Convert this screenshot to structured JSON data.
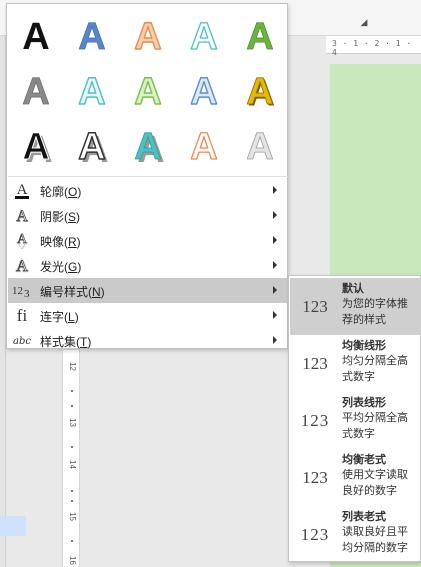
{
  "background": {
    "ruler_top_text": "3 · 1 · 2 · 1 · 4",
    "ruler_left_numbers": [
      "12",
      "13",
      "14",
      "15",
      "16"
    ]
  },
  "wordart_gallery": {
    "letter": "A",
    "styles": [
      {
        "fill": "#111111",
        "stroke": "#111111",
        "effect": "plain"
      },
      {
        "fill": "#5a86c6",
        "stroke": "#3e6db5",
        "effect": "gradient"
      },
      {
        "fill": "#f7cfae",
        "stroke": "#f08a4b",
        "effect": "outline-fill"
      },
      {
        "fill": "#ffffff",
        "stroke": "#4bc2c0",
        "effect": "outline"
      },
      {
        "fill": "#6db33f",
        "stroke": "#4a8f28",
        "effect": "gradient"
      },
      {
        "fill": "#8a8a8a",
        "stroke": "#6a6a6a",
        "effect": "gradient"
      },
      {
        "fill": "#e8f7f6",
        "stroke": "#4bc2c0",
        "effect": "reflection"
      },
      {
        "fill": "#d9f0c8",
        "stroke": "#7ac143",
        "effect": "outline-fill"
      },
      {
        "fill": "#dce8f7",
        "stroke": "#5b8fd1",
        "effect": "outline-fill"
      },
      {
        "fill": "#e7b800",
        "stroke": "#8c6d00",
        "effect": "bevel"
      },
      {
        "fill": "#111111",
        "stroke": "#ffffff",
        "effect": "shadow"
      },
      {
        "fill": "#ffffff",
        "stroke": "#333333",
        "effect": "shadow-outline"
      },
      {
        "fill": "#4bc2c0",
        "stroke": "#2e9c9a",
        "effect": "shadow-color"
      },
      {
        "fill": "#ffffff",
        "stroke": "#f08a4b",
        "effect": "outline"
      },
      {
        "fill": "#e4e4e4",
        "stroke": "#9a9a9a",
        "effect": "gradient"
      }
    ]
  },
  "menu": {
    "items": [
      {
        "label": "轮廓(",
        "key": "O",
        "suffix": ")",
        "icon": "outline-a-icon",
        "selected": false
      },
      {
        "label": "阴影(",
        "key": "S",
        "suffix": ")",
        "icon": "shadow-a-icon",
        "selected": false
      },
      {
        "label": "映像(",
        "key": "R",
        "suffix": ")",
        "icon": "reflection-a-icon",
        "selected": false
      },
      {
        "label": "发光(",
        "key": "G",
        "suffix": ")",
        "icon": "glow-a-icon",
        "selected": false
      },
      {
        "label": "编号样式(",
        "key": "N",
        "suffix": ")",
        "icon": "number-style-icon",
        "selected": true
      },
      {
        "label": "连字(",
        "key": "L",
        "suffix": ")",
        "icon": "ligature-icon",
        "selected": false
      },
      {
        "label": "样式集(",
        "key": "T",
        "suffix": ")",
        "icon": "stylistic-set-icon",
        "selected": false
      }
    ]
  },
  "submenu": {
    "items": [
      {
        "icon_text": "123",
        "title": "默认",
        "desc": "为您的字体推荐的样式",
        "selected": true
      },
      {
        "icon_text": "123",
        "title": "均衡线形",
        "desc": "均匀分隔全高式数字",
        "selected": false
      },
      {
        "icon_text": "123",
        "title": "列表线形",
        "desc": "平均分隔全高式数字",
        "selected": false
      },
      {
        "icon_text": "123",
        "title": "均衡老式",
        "desc": "使用文字读取良好的数字",
        "selected": false
      },
      {
        "icon_text": "123",
        "title": "列表老式",
        "desc": "读取良好且平均分隔的数字",
        "selected": false
      }
    ]
  }
}
